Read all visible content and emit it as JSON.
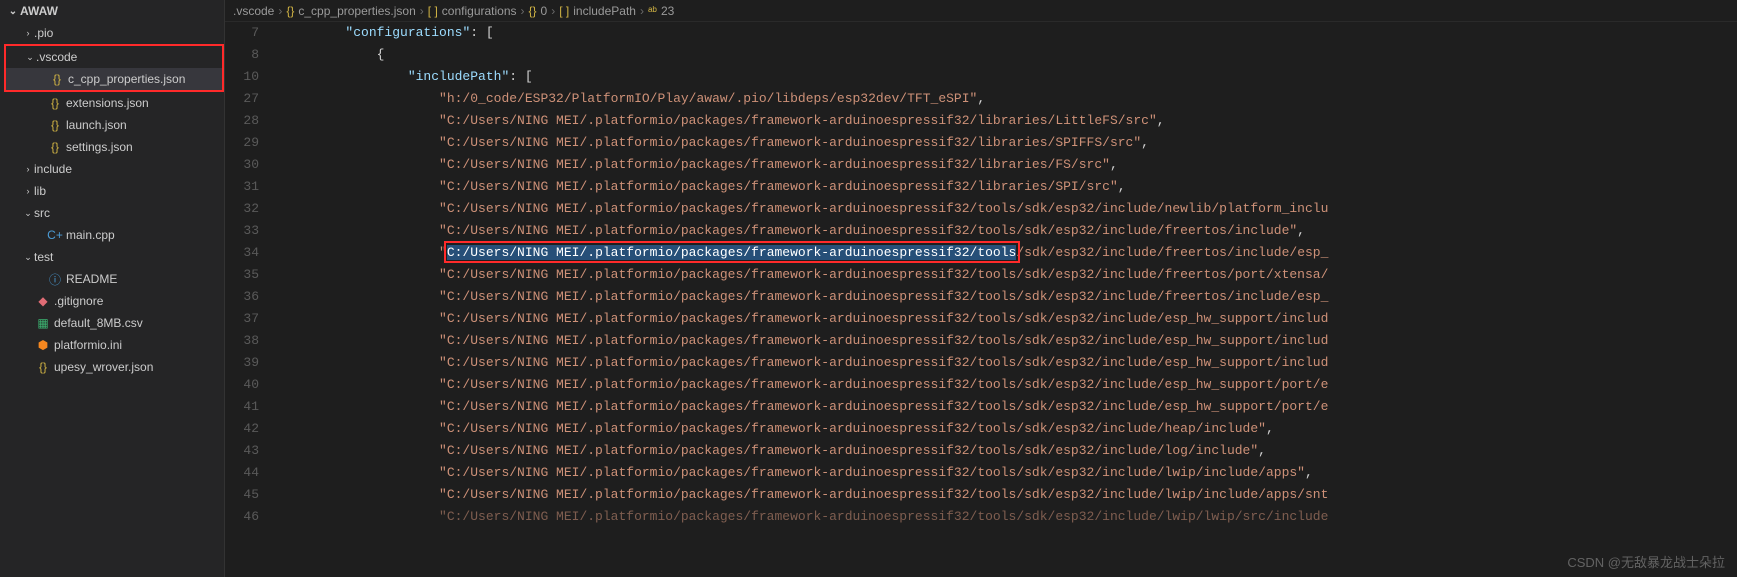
{
  "sidebar": {
    "project": "AWAW",
    "items": [
      {
        "type": "folder",
        "label": ".pio",
        "level": 1,
        "open": false,
        "chev": ">"
      },
      {
        "type": "folder",
        "label": ".vscode",
        "level": 1,
        "open": true,
        "chev": "v",
        "hl": true
      },
      {
        "type": "file",
        "label": "c_cpp_properties.json",
        "level": 2,
        "icon": "{}",
        "cls": "ic-json",
        "active": true,
        "hl": true
      },
      {
        "type": "file",
        "label": "extensions.json",
        "level": 2,
        "icon": "{}",
        "cls": "ic-json"
      },
      {
        "type": "file",
        "label": "launch.json",
        "level": 2,
        "icon": "{}",
        "cls": "ic-json"
      },
      {
        "type": "file",
        "label": "settings.json",
        "level": 2,
        "icon": "{}",
        "cls": "ic-json"
      },
      {
        "type": "folder",
        "label": "include",
        "level": 1,
        "open": false,
        "chev": ">"
      },
      {
        "type": "folder",
        "label": "lib",
        "level": 1,
        "open": false,
        "chev": ">"
      },
      {
        "type": "folder",
        "label": "src",
        "level": 1,
        "open": true,
        "chev": "v"
      },
      {
        "type": "file",
        "label": "main.cpp",
        "level": 2,
        "icon": "C+",
        "cls": "ic-cpp"
      },
      {
        "type": "folder",
        "label": "test",
        "level": 1,
        "open": true,
        "chev": "v"
      },
      {
        "type": "file",
        "label": "README",
        "level": 2,
        "icon": "ⓘ",
        "cls": "ic-readme"
      },
      {
        "type": "file",
        "label": ".gitignore",
        "level": 1,
        "icon": "◆",
        "cls": "ic-git"
      },
      {
        "type": "file",
        "label": "default_8MB.csv",
        "level": 1,
        "icon": "▦",
        "cls": "ic-csv"
      },
      {
        "type": "file",
        "label": "platformio.ini",
        "level": 1,
        "icon": "⬢",
        "cls": "ic-pio"
      },
      {
        "type": "file",
        "label": "upesy_wrover.json",
        "level": 1,
        "icon": "{}",
        "cls": "ic-json"
      }
    ]
  },
  "breadcrumb": {
    "parts": [
      {
        "text": ".vscode",
        "icon": ""
      },
      {
        "text": "c_cpp_properties.json",
        "icon": "{}"
      },
      {
        "text": "configurations",
        "icon": "[ ]"
      },
      {
        "text": "0",
        "icon": "{}"
      },
      {
        "text": "includePath",
        "icon": "[ ]"
      },
      {
        "text": "23",
        "icon": "ᵃᵇ"
      }
    ]
  },
  "code": {
    "lineNumbers": [
      "7",
      "8",
      "10",
      "27",
      "28",
      "29",
      "30",
      "31",
      "32",
      "33",
      "34",
      "35",
      "36",
      "37",
      "38",
      "39",
      "40",
      "41",
      "42",
      "43",
      "44",
      "45",
      "46"
    ],
    "lines": [
      {
        "indent": 8,
        "segs": [
          {
            "t": "\"configurations\"",
            "c": "tok-key"
          },
          {
            "t": ": [",
            "c": "tok-punc"
          }
        ]
      },
      {
        "indent": 12,
        "segs": [
          {
            "t": "{",
            "c": "tok-punc"
          }
        ]
      },
      {
        "indent": 16,
        "segs": [
          {
            "t": "\"includePath\"",
            "c": "tok-key"
          },
          {
            "t": ": [",
            "c": "tok-punc"
          }
        ]
      },
      {
        "indent": 20,
        "segs": [
          {
            "t": "\"h:/0_code/ESP32/PlatformIO/Play/awaw/.pio/libdeps/esp32dev/TFT_eSPI\"",
            "c": "tok-str"
          },
          {
            "t": ",",
            "c": "tok-punc"
          }
        ]
      },
      {
        "indent": 20,
        "segs": [
          {
            "t": "\"C:/Users/NING MEI/.platformio/packages/framework-arduinoespressif32/libraries/LittleFS/src\"",
            "c": "tok-str"
          },
          {
            "t": ",",
            "c": "tok-punc"
          }
        ]
      },
      {
        "indent": 20,
        "segs": [
          {
            "t": "\"C:/Users/NING MEI/.platformio/packages/framework-arduinoespressif32/libraries/SPIFFS/src\"",
            "c": "tok-str"
          },
          {
            "t": ",",
            "c": "tok-punc"
          }
        ]
      },
      {
        "indent": 20,
        "segs": [
          {
            "t": "\"C:/Users/NING MEI/.platformio/packages/framework-arduinoespressif32/libraries/FS/src\"",
            "c": "tok-str"
          },
          {
            "t": ",",
            "c": "tok-punc"
          }
        ]
      },
      {
        "indent": 20,
        "segs": [
          {
            "t": "\"C:/Users/NING MEI/.platformio/packages/framework-arduinoespressif32/libraries/SPI/src\"",
            "c": "tok-str"
          },
          {
            "t": ",",
            "c": "tok-punc"
          }
        ]
      },
      {
        "indent": 20,
        "segs": [
          {
            "t": "\"C:/Users/NING MEI/.platformio/packages/framework-arduinoespressif32/tools/sdk/esp32/include/newlib/platform_inclu",
            "c": "tok-str"
          }
        ]
      },
      {
        "indent": 20,
        "segs": [
          {
            "t": "\"C:/Users/NING MEI/.platformio/packages/framework-arduinoespressif32/tools/sdk/esp32/include/freertos/include\"",
            "c": "tok-str"
          },
          {
            "t": ",",
            "c": "tok-punc"
          }
        ]
      },
      {
        "indent": 20,
        "segs": [
          {
            "t": "\"",
            "c": "tok-str"
          },
          {
            "t": "C:/Users/NING MEI/.platformio/packages/framework-arduinoespressif32/tools",
            "c": "tok-str",
            "sel": true
          },
          {
            "t": "/sdk/esp32/include/freertos/include/esp_",
            "c": "tok-str"
          }
        ],
        "hlLine": true
      },
      {
        "indent": 20,
        "segs": [
          {
            "t": "\"C:/Users/NING MEI/.platformio/packages/framework-arduinoespressif32/tools/sdk/esp32/include/freertos/port/xtensa/",
            "c": "tok-str"
          }
        ]
      },
      {
        "indent": 20,
        "segs": [
          {
            "t": "\"C:/Users/NING MEI/.platformio/packages/framework-arduinoespressif32/tools/sdk/esp32/include/freertos/include/esp_",
            "c": "tok-str"
          }
        ]
      },
      {
        "indent": 20,
        "segs": [
          {
            "t": "\"C:/Users/NING MEI/.platformio/packages/framework-arduinoespressif32/tools/sdk/esp32/include/esp_hw_support/includ",
            "c": "tok-str"
          }
        ]
      },
      {
        "indent": 20,
        "segs": [
          {
            "t": "\"C:/Users/NING MEI/.platformio/packages/framework-arduinoespressif32/tools/sdk/esp32/include/esp_hw_support/includ",
            "c": "tok-str"
          }
        ]
      },
      {
        "indent": 20,
        "segs": [
          {
            "t": "\"C:/Users/NING MEI/.platformio/packages/framework-arduinoespressif32/tools/sdk/esp32/include/esp_hw_support/includ",
            "c": "tok-str"
          }
        ]
      },
      {
        "indent": 20,
        "segs": [
          {
            "t": "\"C:/Users/NING MEI/.platformio/packages/framework-arduinoespressif32/tools/sdk/esp32/include/esp_hw_support/port/e",
            "c": "tok-str"
          }
        ]
      },
      {
        "indent": 20,
        "segs": [
          {
            "t": "\"C:/Users/NING MEI/.platformio/packages/framework-arduinoespressif32/tools/sdk/esp32/include/esp_hw_support/port/e",
            "c": "tok-str"
          }
        ]
      },
      {
        "indent": 20,
        "segs": [
          {
            "t": "\"C:/Users/NING MEI/.platformio/packages/framework-arduinoespressif32/tools/sdk/esp32/include/heap/include\"",
            "c": "tok-str"
          },
          {
            "t": ",",
            "c": "tok-punc"
          }
        ]
      },
      {
        "indent": 20,
        "segs": [
          {
            "t": "\"C:/Users/NING MEI/.platformio/packages/framework-arduinoespressif32/tools/sdk/esp32/include/log/include\"",
            "c": "tok-str"
          },
          {
            "t": ",",
            "c": "tok-punc"
          }
        ]
      },
      {
        "indent": 20,
        "segs": [
          {
            "t": "\"C:/Users/NING MEI/.platformio/packages/framework-arduinoespressif32/tools/sdk/esp32/include/lwip/include/apps\"",
            "c": "tok-str"
          },
          {
            "t": ",",
            "c": "tok-punc"
          }
        ]
      },
      {
        "indent": 20,
        "segs": [
          {
            "t": "\"C:/Users/NING MEI/.platformio/packages/framework-arduinoespressif32/tools/sdk/esp32/include/lwip/include/apps/snt",
            "c": "tok-str"
          }
        ]
      },
      {
        "indent": 20,
        "segs": [
          {
            "t": "\"C:/Users/NING MEI/.platformio/packages/framework-arduinoespressif32/tools/sdk/esp32/include/lwip/lwip/src/include",
            "c": "tok-str"
          }
        ],
        "cut": true
      }
    ]
  },
  "watermark": "CSDN @无敌暴龙战士朵拉"
}
